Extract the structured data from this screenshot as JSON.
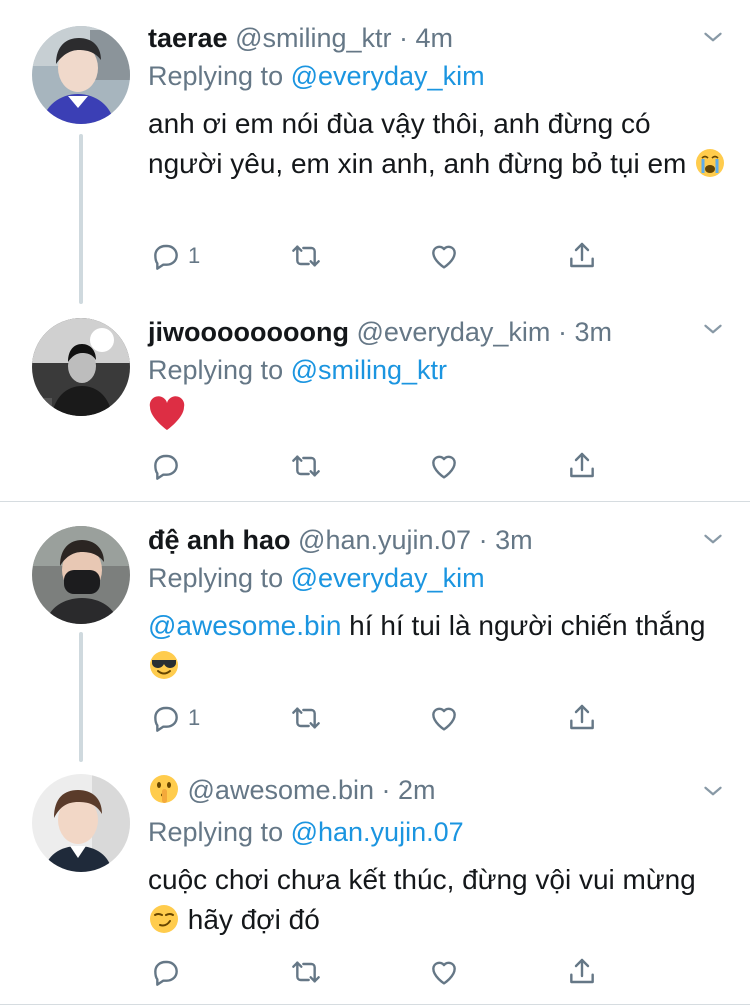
{
  "tweets": [
    {
      "name": "taerae",
      "handle": "@smiling_ktr",
      "time": "4m",
      "replying_prefix": "Replying to ",
      "replying_to": "@everyday_kim",
      "text": "anh ơi em nói đùa vậy thôi, anh đừng có người yêu, em xin anh, anh đừng bỏ tụi em",
      "emoji_icon": "loudly-crying-face",
      "reply_count": "1"
    },
    {
      "name": "jiwoooooooong",
      "handle": "@everyday_kim",
      "time": "3m",
      "replying_prefix": "Replying to ",
      "replying_to": "@smiling_ktr",
      "emoji_icon": "red-heart"
    },
    {
      "name": "đệ anh hao",
      "handle": "@han.yujin.07",
      "time": "3m",
      "replying_prefix": "Replying to ",
      "replying_to": "@everyday_kim",
      "mention": "@awesome.bin",
      "text": " hí hí tui là người chiến thắng",
      "emoji_icon": "smiling-face-with-sunglasses",
      "reply_count": "1"
    },
    {
      "name_emoji_icon": "shushing-face",
      "handle": "@awesome.bin",
      "time": "2m",
      "replying_prefix": "Replying to ",
      "replying_to": "@han.yujin.07",
      "text_part1": "cuộc chơi chưa kết thúc, đừng vội vui mừng",
      "text_part2": " hãy đợi đó",
      "emoji_icon": "smirking-face"
    }
  ],
  "separator": " · ",
  "colors": {
    "link": "#1b95e0",
    "meta": "#657786",
    "thread_line": "#cfd9de",
    "heart_red": "#e0245e"
  }
}
